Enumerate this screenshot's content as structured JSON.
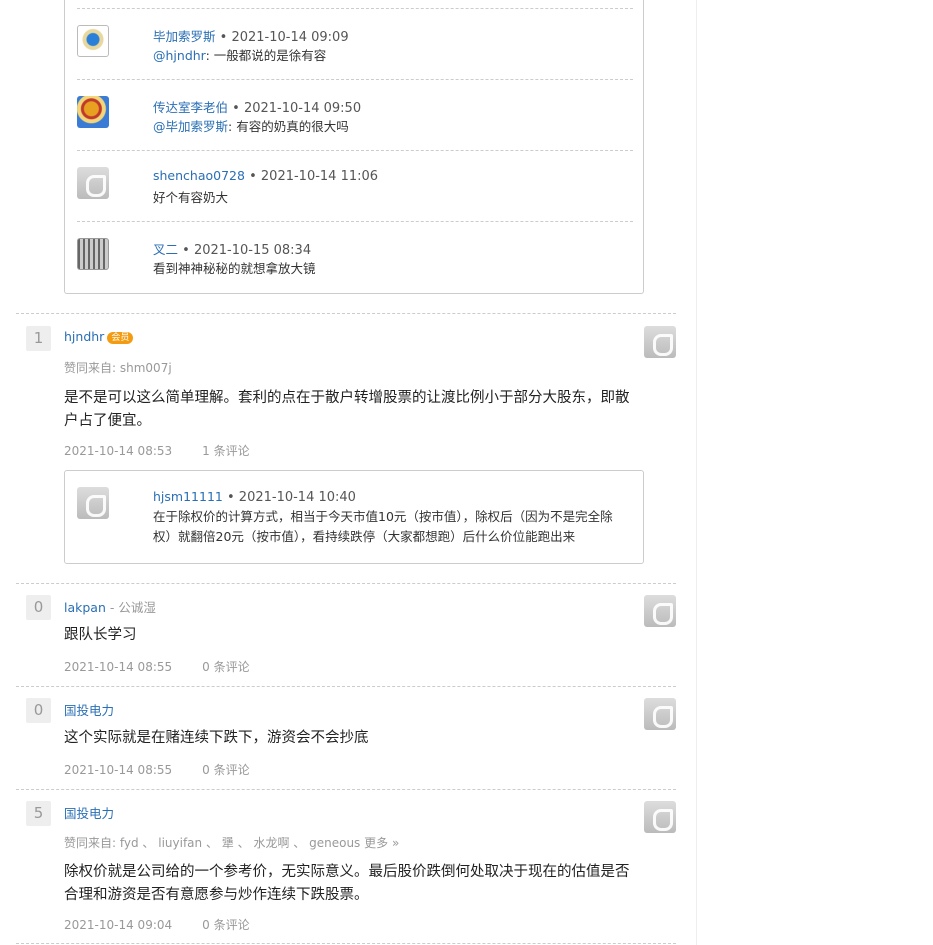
{
  "top_replies": [
    {
      "user": "毕加索罗斯",
      "time": "2021-10-14 09:09",
      "mention": "@hjndhr",
      "text": ": 一般都说的是徐有容",
      "avatar": "painting-avatar"
    },
    {
      "user": "传达室李老伯",
      "time": "2021-10-14 09:50",
      "mention": "@毕加索罗斯",
      "text": ": 有容的奶真的很大吗",
      "avatar": "cartoon-avatar"
    },
    {
      "user": "shenchao0728",
      "time": "2021-10-14 11:06",
      "mention": "",
      "text": "好个有容奶大",
      "avatar": "default-avatar"
    },
    {
      "user": "叉二",
      "time": "2021-10-15 08:34",
      "mention": "",
      "text": "看到神神秘秘的就想拿放大镜",
      "avatar": "calligraphy-avatar"
    }
  ],
  "answers": [
    {
      "votes": "1",
      "user": "hjndhr",
      "badge": "会员",
      "signature": "",
      "agree_label": "赞同来自:",
      "agree_users": [
        "shm007j"
      ],
      "content": "是不是可以这么简单理解。套利的点在于散户转增股票的让渡比例小于部分大股东，即散户占了便宜。",
      "time": "2021-10-14 08:53",
      "comments": "1 条评论",
      "reply": {
        "user": "hjsm11111",
        "time": "2021-10-14 10:40",
        "text": "在于除权价的计算方式，相当于今天市值10元（按市值），除权后（因为不是完全除权）就翻倍20元（按市值），看持续跌停（大家都想跑）后什么价位能跑出来"
      }
    },
    {
      "votes": "0",
      "user": "lakpan",
      "signature": "公诚湿",
      "content": "跟队长学习",
      "time": "2021-10-14 08:55",
      "comments": "0 条评论"
    },
    {
      "votes": "0",
      "user": "国投电力",
      "signature": "",
      "content": "这个实际就是在赌连续下跌下，游资会不会抄底",
      "time": "2021-10-14 08:55",
      "comments": "0 条评论"
    },
    {
      "votes": "5",
      "user": "国投电力",
      "signature": "",
      "agree_label": "赞同来自:",
      "agree_users": [
        "fyd",
        "liuyifan",
        "犟",
        "水龙啊",
        "geneous"
      ],
      "agree_more": "更多 »",
      "content": "除权价就是公司给的一个参考价，无实际意义。最后股价跌倒何处取决于现在的估值是否合理和游资是否有意愿参与炒作连续下跌股票。",
      "time": "2021-10-14 09:04",
      "comments": "0 条评论"
    }
  ]
}
